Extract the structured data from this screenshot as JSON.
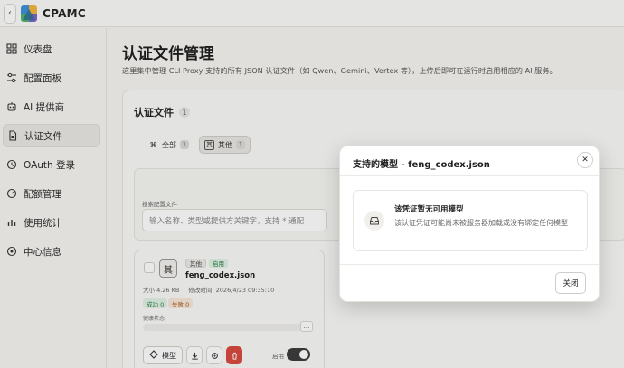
{
  "header": {
    "brand": "CPAMC",
    "back_icon": "chevron-left-icon"
  },
  "sidebar": {
    "items": [
      {
        "label": "仪表盘",
        "icon": "dashboard-icon",
        "active": false
      },
      {
        "label": "配置面板",
        "icon": "sliders-icon",
        "active": false
      },
      {
        "label": "AI 提供商",
        "icon": "robot-icon",
        "active": false
      },
      {
        "label": "认证文件",
        "icon": "file-icon",
        "active": true
      },
      {
        "label": "OAuth 登录",
        "icon": "shield-icon",
        "active": false
      },
      {
        "label": "配额管理",
        "icon": "gauge-icon",
        "active": false
      },
      {
        "label": "使用统计",
        "icon": "chart-icon",
        "active": false
      },
      {
        "label": "中心信息",
        "icon": "info-icon",
        "active": false
      }
    ]
  },
  "main": {
    "title": "认证文件管理",
    "description": "这里集中管理 CLI Proxy 支持的所有 JSON 认证文件（如 Qwen、Gemini、Vertex 等），上传后即可在运行时启用相应的 AI 服务。",
    "card": {
      "title": "认证文件",
      "count": "1",
      "filters": [
        {
          "label": "全部",
          "count": "1",
          "icon": "⌘",
          "active": false
        },
        {
          "label": "其他",
          "count": "1",
          "icon": "其",
          "active": true
        }
      ],
      "search": {
        "label": "搜索配置文件",
        "placeholder": "输入名称、类型或提供方关键字，支持 * 通配"
      },
      "file": {
        "type_icon": "其",
        "type_badge": "其他",
        "enabled_badge": "启用",
        "name": "feng_codex.json",
        "size": "大小 4.26 KB",
        "modified": "修改时间: 2026/4/23 09:35:10",
        "success": "成功 0",
        "fail": "失败 0",
        "health_label": "健康状态",
        "more": "...",
        "models_label": "模型",
        "enable_label": "启用"
      }
    }
  },
  "modal": {
    "title": "支持的模型 - feng_codex.json",
    "empty_title": "该凭证暂无可用模型",
    "empty_desc": "该认证凭证可能尚未被服务器加载或没有绑定任何模型",
    "close_label": "关闭"
  },
  "colors": {
    "accent": "#1f1f1f",
    "danger": "#d9483b",
    "success": "#2d7a45"
  }
}
